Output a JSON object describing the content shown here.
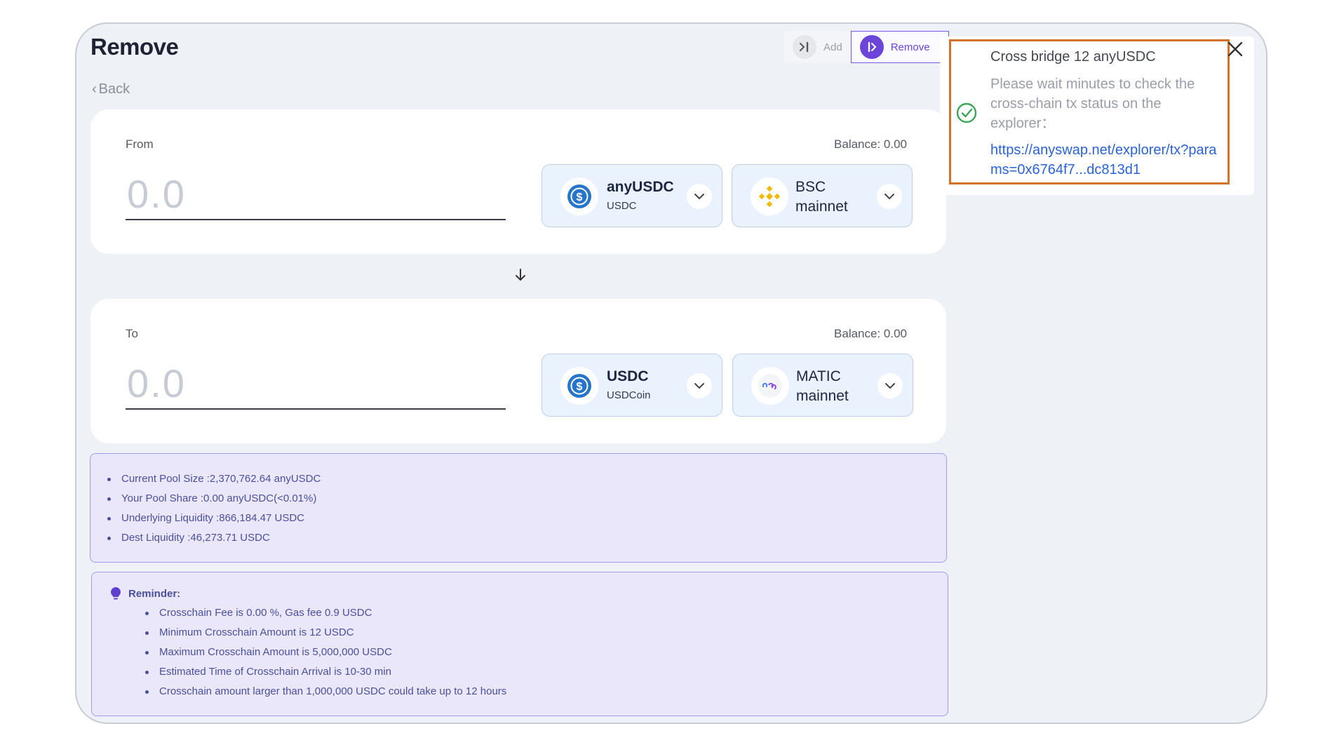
{
  "header": {
    "title": "Remove",
    "back_label": "Back"
  },
  "tabs": [
    {
      "label": "Add",
      "icon": "add-liquidity-icon",
      "active": false
    },
    {
      "label": "Remove",
      "icon": "remove-liquidity-icon",
      "active": true
    }
  ],
  "from": {
    "label": "From",
    "balance": "Balance: 0.00",
    "amount_placeholder": "0.0",
    "token": {
      "name": "anyUSDC",
      "sub": "USDC",
      "icon": "usdc-icon"
    },
    "chain": {
      "name": "BSC mainnet",
      "icon": "bsc-icon"
    }
  },
  "to": {
    "label": "To",
    "balance": "Balance: 0.00",
    "amount_placeholder": "0.0",
    "token": {
      "name": "USDC",
      "sub": "USDCoin",
      "icon": "usdc-icon"
    },
    "chain": {
      "name": "MATIC mainnet",
      "icon": "matic-icon"
    }
  },
  "pool_info": [
    "Current Pool Size :2,370,762.64 anyUSDC",
    "Your Pool Share :0.00 anyUSDC(<0.01%)",
    "Underlying Liquidity :866,184.47 USDC",
    "Dest Liquidity :46,273.71 USDC"
  ],
  "reminder": {
    "title": "Reminder:",
    "items": [
      "Crosschain Fee is 0.00 %, Gas fee 0.9 USDC",
      "Minimum Crosschain Amount is 12 USDC",
      "Maximum Crosschain Amount is 5,000,000 USDC",
      "Estimated Time of Crosschain Arrival is 10-30 min",
      "Crosschain amount larger than 1,000,000 USDC could take up to 12 hours"
    ]
  },
  "toast": {
    "title": "Cross bridge 12 anyUSDC",
    "message": "Please wait minutes to check the cross-chain tx status on the explorer：",
    "link": "https://anyswap.net/explorer/tx?params=0x6764f7...dc813d1"
  },
  "colors": {
    "accent": "#6a45d8",
    "selector_bg": "#eaf2fd",
    "info_bg": "#ebe7fb",
    "link": "#2a63d6",
    "highlight_border": "#d4722a",
    "success": "#3aa55a"
  }
}
